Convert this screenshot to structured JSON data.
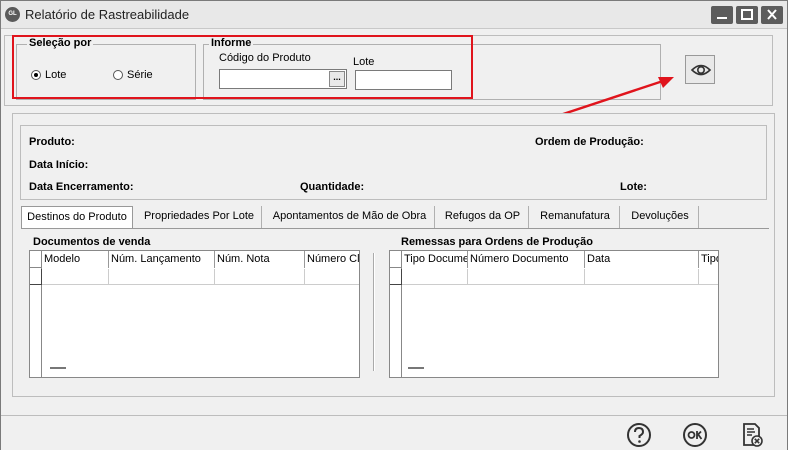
{
  "window": {
    "title": "Relatório de Rastreabilidade",
    "icon_text": "GL"
  },
  "selecao": {
    "title": "Seleção por",
    "options": [
      {
        "label": "Lote",
        "selected": true
      },
      {
        "label": "Série",
        "selected": false
      }
    ]
  },
  "informe": {
    "title": "Informe",
    "codigo_label": "Código do Produto",
    "codigo_value": "",
    "lookup_label": "...",
    "lote_label": "Lote",
    "lote_value": ""
  },
  "info": {
    "produto": "Produto:",
    "ordem_producao": "Ordem de Produção:",
    "data_inicio": "Data Início:",
    "data_encerramento": "Data Encerramento:",
    "quantidade": "Quantidade:",
    "lote": "Lote:"
  },
  "tabs": [
    "Destinos do Produto",
    "Propriedades Por Lote",
    "Apontamentos de Mão de Obra",
    "Refugos da OP",
    "Remanufatura",
    "Devoluções"
  ],
  "active_tab": 0,
  "documentos_venda": {
    "title": "Documentos de venda",
    "columns": [
      "Modelo",
      "Núm. Lançamento",
      "Núm. Nota",
      "Número Cli"
    ]
  },
  "remessas": {
    "title": "Remessas para Ordens de Produção",
    "columns": [
      "Tipo Docume",
      "Número Documento",
      "Data",
      "Tipo"
    ]
  },
  "colors": {
    "highlight_red": "#e0141c"
  }
}
